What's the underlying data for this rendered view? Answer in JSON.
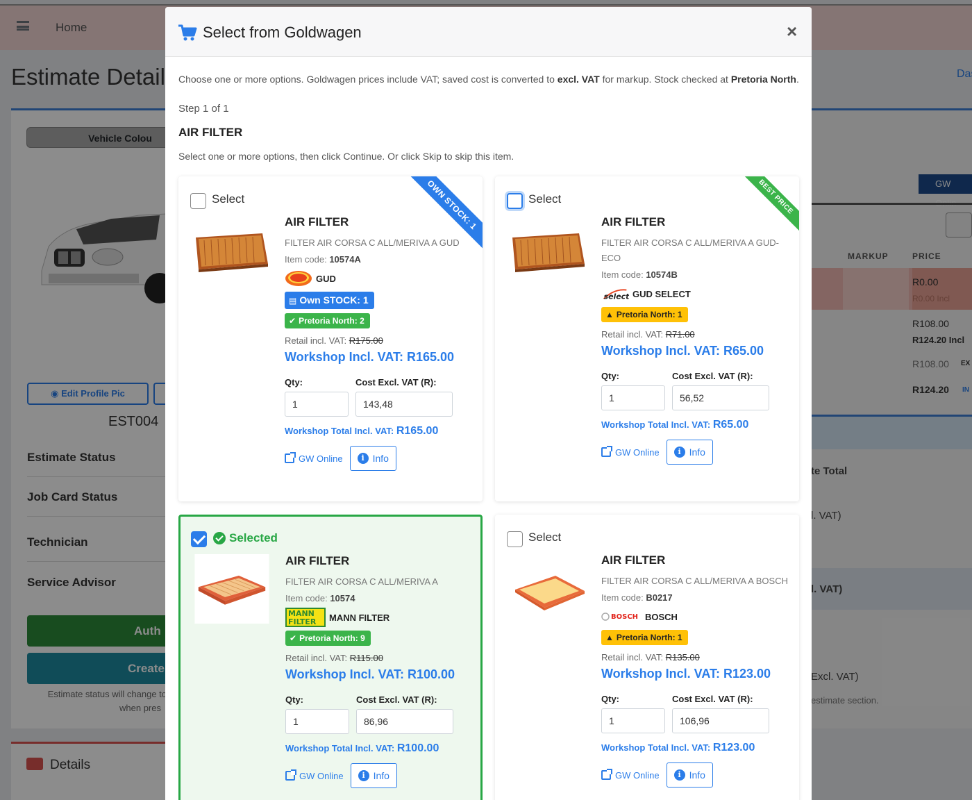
{
  "background": {
    "nav_home": "Home",
    "page_title": "Estimate Detail",
    "right_link": "Das",
    "vehicle_colour": "Vehicle Colou",
    "edit_profile_pic": "Edit Profile Pic",
    "estimate_no": "EST004",
    "labels": [
      "Estimate Status",
      "Job Card Status",
      "Technician",
      "Service Advisor"
    ],
    "auth_button": "Auth",
    "create_button": "Create",
    "status_note_1": "Estimate status will change to",
    "status_note_2": "when pres",
    "details_title": "Details",
    "gw_online_btn": "GW Onlin",
    "col_markup": "MARKUP",
    "col_price": "PRICE",
    "prices": [
      "R0.00",
      "R0.00 Incl",
      "R108.00",
      "R124.20 Incl",
      "R108.00",
      "EX",
      "R124.20",
      "IN"
    ],
    "right_texts": [
      "te Total",
      "l. VAT)",
      "l. VAT)",
      "Excl. VAT)",
      "estimate section."
    ]
  },
  "modal": {
    "title": "Select from Goldwagen",
    "close": "×",
    "intro_pre": "Choose one or more options. Goldwagen prices include VAT; saved cost is converted to ",
    "intro_bold1": "excl. VAT",
    "intro_mid": " for markup. Stock checked at ",
    "intro_bold2": "Pretoria North",
    "intro_end": ".",
    "step": "Step 1 of 1",
    "section_title": "AIR FILTER",
    "section_sub": "Select one or more options, then click Continue. Or click Skip to skip this item.",
    "select_label": "Select",
    "selected_label": "Selected",
    "code_label": "Item code:",
    "retail_label": "Retail incl. VAT:",
    "qty_label": "Qty:",
    "cost_label": "Cost Excl. VAT (R):",
    "total_label": "Workshop Total Incl. VAT:",
    "gw_online": "GW Online",
    "info": "Info",
    "products": [
      {
        "title": "AIR FILTER",
        "desc": "FILTER AIR CORSA C ALL/MERIVA A GUD",
        "code": "10574A",
        "brand": "GUD",
        "ribbon": "OWN STOCK: 1",
        "own_stock": "Own STOCK: 1",
        "stock": "Pretoria North: 2",
        "retail": "R175.00",
        "workshop": "Workshop Incl. VAT: R165.00",
        "qty": "1",
        "cost": "143,48",
        "total": "R165.00"
      },
      {
        "title": "AIR FILTER",
        "desc": "FILTER AIR CORSA C ALL/MERIVA A GUD-ECO",
        "code": "10574B",
        "brand": "GUD SELECT",
        "ribbon": "BEST PRICE",
        "stock": "Pretoria North: 1",
        "retail": "R71.00",
        "workshop": "Workshop Incl. VAT: R65.00",
        "qty": "1",
        "cost": "56,52",
        "total": "R65.00"
      },
      {
        "title": "AIR FILTER",
        "desc": "FILTER AIR CORSA C ALL/MERIVA A",
        "code": "10574",
        "brand": "MANN FILTER",
        "stock": "Pretoria North: 9",
        "retail": "R115.00",
        "workshop": "Workshop Incl. VAT: R100.00",
        "qty": "1",
        "cost": "86,96",
        "total": "R100.00"
      },
      {
        "title": "AIR FILTER",
        "desc": "FILTER AIR CORSA C ALL/MERIVA A BOSCH",
        "code": "B0217",
        "brand": "BOSCH",
        "stock": "Pretoria North: 1",
        "retail": "R135.00",
        "workshop": "Workshop Incl. VAT: R123.00",
        "qty": "1",
        "cost": "106,96",
        "total": "R123.00"
      }
    ]
  },
  "colors": {
    "primary": "#2b7de9",
    "success": "#28a745",
    "warning": "#ffc107"
  }
}
